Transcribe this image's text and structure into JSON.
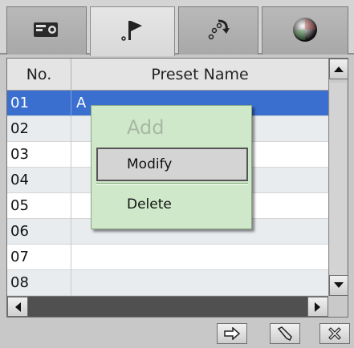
{
  "tabs": [
    {
      "icon": "camera-settings-icon",
      "active": false
    },
    {
      "icon": "flag-preset-icon",
      "active": true
    },
    {
      "icon": "tour-path-icon",
      "active": false
    },
    {
      "icon": "color-ball-icon",
      "active": false
    }
  ],
  "table": {
    "col_no": "No.",
    "col_name": "Preset Name",
    "rows": [
      {
        "no": "01",
        "name": "A"
      },
      {
        "no": "02",
        "name": ""
      },
      {
        "no": "03",
        "name": ""
      },
      {
        "no": "04",
        "name": ""
      },
      {
        "no": "05",
        "name": ""
      },
      {
        "no": "06",
        "name": ""
      },
      {
        "no": "07",
        "name": ""
      },
      {
        "no": "08",
        "name": ""
      }
    ],
    "selected_row": "01"
  },
  "context_menu": {
    "add": "Add",
    "modify": "Modify",
    "delete": "Delete",
    "add_enabled": false
  },
  "toolbar": {
    "buttons": [
      "arrow-right-icon",
      "edit-pencil-icon",
      "close-x-icon"
    ]
  },
  "colors": {
    "selection": "#3a6fd0",
    "menu_bg": "#cfe8c9"
  }
}
